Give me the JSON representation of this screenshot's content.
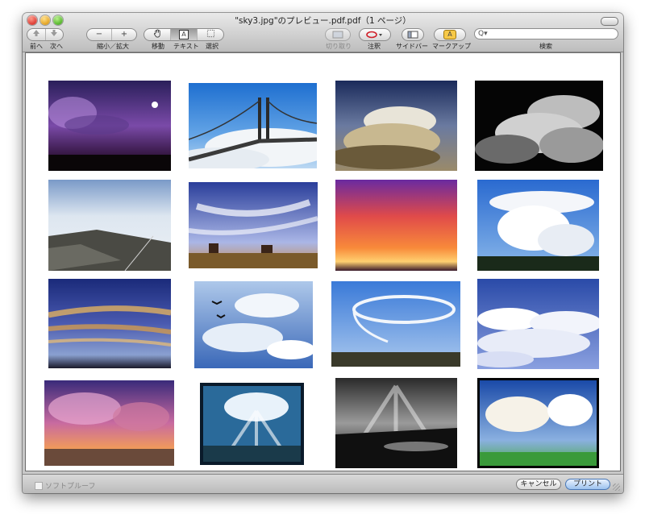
{
  "window": {
    "title": "\"sky3.jpg\"のプレビュー.pdf.pdf（1 ページ）"
  },
  "toolbar": {
    "nav_label_prev": "前へ",
    "nav_label_next": "次へ",
    "zoom_label": "縮小／拡大",
    "zoom_out_glyph": "−",
    "zoom_in_glyph": "+",
    "move_label": "移動",
    "text_label": "テキスト",
    "select_label": "選択",
    "text_glyph": "A",
    "crop_label": "切り取り",
    "annotate_label": "注釈",
    "sidebar_label": "サイドバー",
    "markup_label": "マークアップ",
    "markup_glyph": "A",
    "search_label": "検索",
    "search_placeholder": "Q▾"
  },
  "photos": [
    {
      "name": "night-storm-moon"
    },
    {
      "name": "golden-gate-fog"
    },
    {
      "name": "storm-cloud-sunlit"
    },
    {
      "name": "bw-cumulus"
    },
    {
      "name": "above-clouds-rocks"
    },
    {
      "name": "monument-valley-sky"
    },
    {
      "name": "red-sunset"
    },
    {
      "name": "cumulonimbus-tower"
    },
    {
      "name": "golden-streak-sky"
    },
    {
      "name": "birds-in-clouds"
    },
    {
      "name": "ring-cloud"
    },
    {
      "name": "sea-of-clouds"
    },
    {
      "name": "pink-storm-desert"
    },
    {
      "name": "sunrays-blue-frame"
    },
    {
      "name": "bw-sunrays-coast"
    },
    {
      "name": "clouds-green-field"
    }
  ],
  "footer": {
    "softproof_label": "ソフトプルーフ",
    "cancel_label": "キャンセル",
    "print_label": "プリント"
  }
}
